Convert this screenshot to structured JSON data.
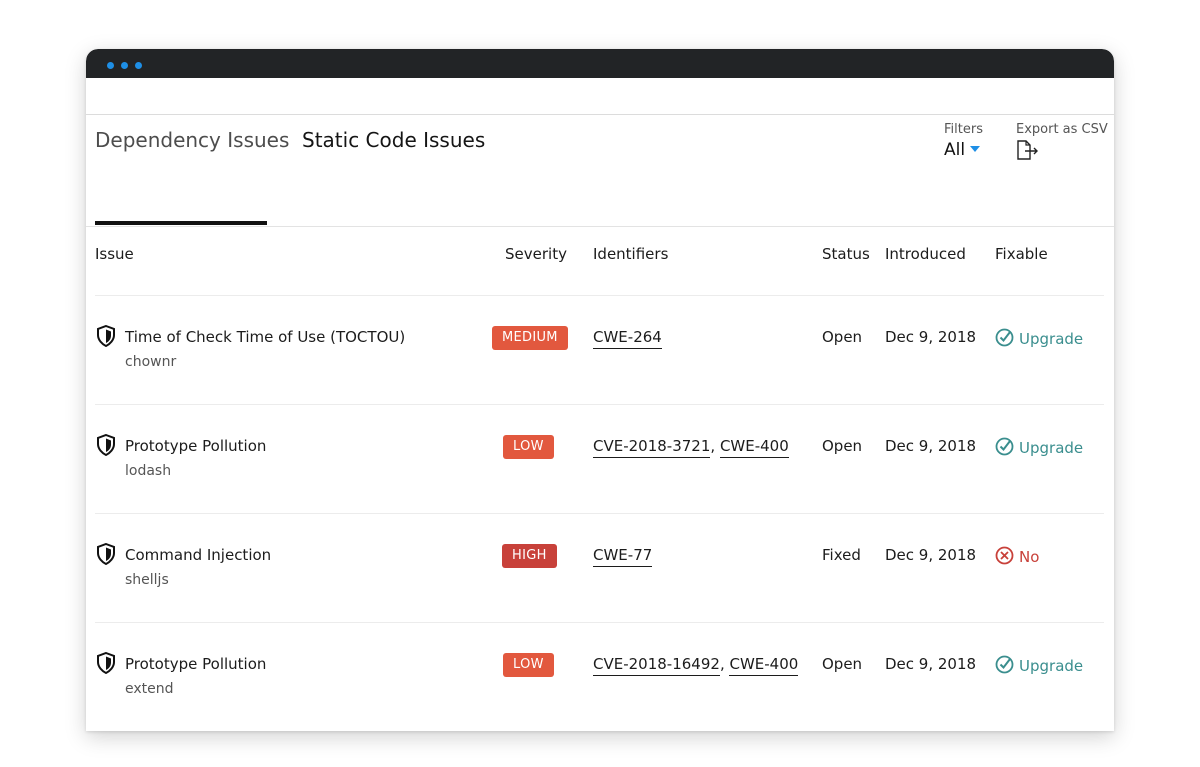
{
  "colors": {
    "titlebar": "#222426",
    "dot": "#1e8fe6",
    "medium": "#e2583e",
    "low": "#e2583e",
    "high": "#c8413a",
    "fixable_yes": "#3a8e8e",
    "fixable_no": "#c8413a"
  },
  "tabs": [
    {
      "label": "Dependency Issues",
      "active": true
    },
    {
      "label": "Static Code Issues",
      "active": false
    }
  ],
  "filters": {
    "label": "Filters",
    "value": "All"
  },
  "export": {
    "label": "Export as CSV",
    "icon": "export-file-icon"
  },
  "table": {
    "headers": [
      "Issue",
      "Severity",
      "Identifiers",
      "Status",
      "Introduced",
      "Fixable"
    ],
    "rows": [
      {
        "title": "Time of Check Time of Use (TOCTOU)",
        "package": "chownr",
        "severity": "MEDIUM",
        "identifiers": [
          "CWE-264"
        ],
        "status": "Open",
        "introduced": "Dec 9, 2018",
        "fixable": "Upgrade",
        "fixable_icon": "check-circle-icon"
      },
      {
        "title": "Prototype Pollution",
        "package": "lodash",
        "severity": "LOW",
        "identifiers": [
          "CVE-2018-3721",
          "CWE-400"
        ],
        "status": "Open",
        "introduced": "Dec 9, 2018",
        "fixable": "Upgrade",
        "fixable_icon": "check-circle-icon"
      },
      {
        "title": "Command Injection",
        "package": "shelljs",
        "severity": "HIGH",
        "identifiers": [
          "CWE-77"
        ],
        "status": "Fixed",
        "introduced": "Dec 9, 2018",
        "fixable": "No",
        "fixable_icon": "x-circle-icon"
      },
      {
        "title": "Prototype Pollution",
        "package": "extend",
        "severity": "LOW",
        "identifiers": [
          "CVE-2018-16492",
          "CWE-400"
        ],
        "status": "Open",
        "introduced": "Dec 9, 2018",
        "fixable": "Upgrade",
        "fixable_icon": "check-circle-icon"
      }
    ]
  }
}
